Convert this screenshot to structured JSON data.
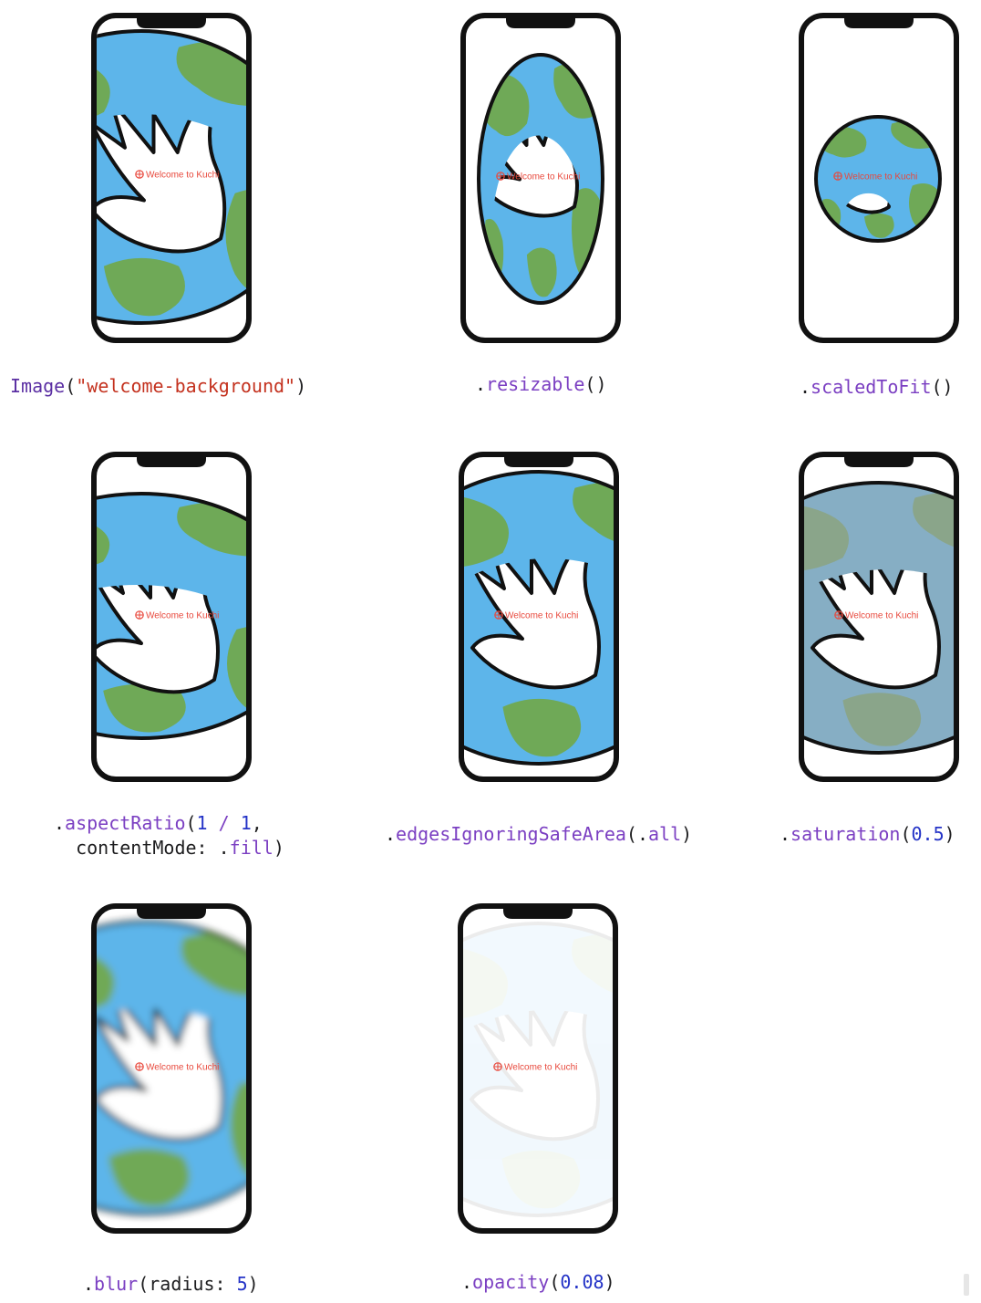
{
  "banner_text": "Welcome to Kuchi",
  "colors": {
    "ocean": "#5db5ea",
    "ocean_desat": "#86aec4",
    "land": "#6fa957",
    "land_desat": "#8aa58a",
    "outline": "#111111",
    "banner": "#e8483c"
  },
  "panels": [
    {
      "id": "image",
      "caption": [
        [
          {
            "t": "Image",
            "k": "type"
          },
          {
            "t": "(",
            "k": "plain"
          },
          {
            "t": "\"welcome-background\"",
            "k": "str"
          },
          {
            "t": ")",
            "k": "plain"
          }
        ]
      ]
    },
    {
      "id": "resizable",
      "caption": [
        [
          {
            "t": ".",
            "k": "plain"
          },
          {
            "t": "resizable",
            "k": "member"
          },
          {
            "t": "()",
            "k": "plain"
          }
        ]
      ]
    },
    {
      "id": "scaled-to-fit",
      "caption": [
        [
          {
            "t": ".",
            "k": "plain"
          },
          {
            "t": "scaledToFit",
            "k": "member"
          },
          {
            "t": "()",
            "k": "plain"
          }
        ]
      ]
    },
    {
      "id": "aspect-ratio",
      "caption": [
        [
          {
            "t": ".",
            "k": "plain"
          },
          {
            "t": "aspectRatio",
            "k": "member"
          },
          {
            "t": "(",
            "k": "plain"
          },
          {
            "t": "1",
            "k": "num"
          },
          {
            "t": " / ",
            "k": "member"
          },
          {
            "t": "1",
            "k": "num"
          },
          {
            "t": ",",
            "k": "plain"
          }
        ],
        [
          {
            "t": "  contentMode: .",
            "k": "plain"
          },
          {
            "t": "fill",
            "k": "member"
          },
          {
            "t": ")",
            "k": "plain"
          }
        ]
      ]
    },
    {
      "id": "edges-ignoring-safe-area",
      "caption": [
        [
          {
            "t": ".",
            "k": "plain"
          },
          {
            "t": "edgesIgnoringSafeArea",
            "k": "member"
          },
          {
            "t": "(.",
            "k": "plain"
          },
          {
            "t": "all",
            "k": "member"
          },
          {
            "t": ")",
            "k": "plain"
          }
        ]
      ]
    },
    {
      "id": "saturation",
      "caption": [
        [
          {
            "t": ".",
            "k": "plain"
          },
          {
            "t": "saturation",
            "k": "member"
          },
          {
            "t": "(",
            "k": "plain"
          },
          {
            "t": "0.5",
            "k": "num"
          },
          {
            "t": ")",
            "k": "plain"
          }
        ]
      ]
    },
    {
      "id": "blur",
      "caption": [
        [
          {
            "t": ".",
            "k": "plain"
          },
          {
            "t": "blur",
            "k": "member"
          },
          {
            "t": "(radius: ",
            "k": "plain"
          },
          {
            "t": "5",
            "k": "num"
          },
          {
            "t": ")",
            "k": "plain"
          }
        ]
      ]
    },
    {
      "id": "opacity",
      "caption": [
        [
          {
            "t": ".",
            "k": "plain"
          },
          {
            "t": "opacity",
            "k": "member"
          },
          {
            "t": "(",
            "k": "plain"
          },
          {
            "t": "0.08",
            "k": "num"
          },
          {
            "t": ")",
            "k": "plain"
          }
        ]
      ]
    }
  ]
}
